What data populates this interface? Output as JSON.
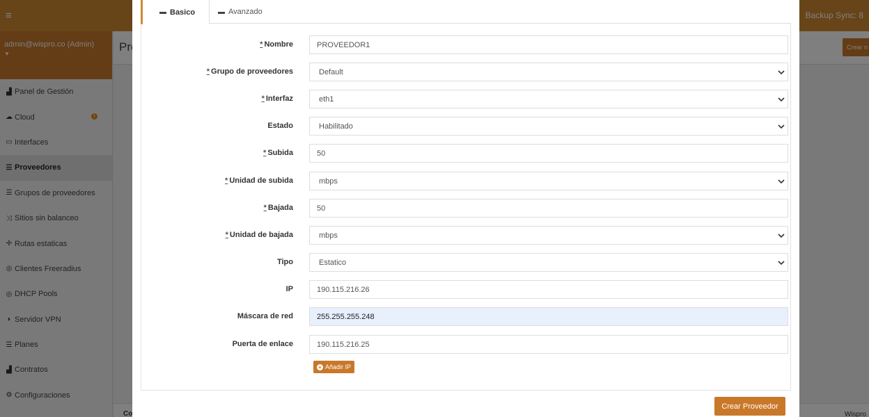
{
  "topbar": {
    "menu_icon": "hamburger-icon",
    "sync_text": "Backup Sync: 8"
  },
  "user": {
    "name": "admin@wispro.co (Admin)"
  },
  "sidebar": {
    "items": [
      {
        "label": "Panel de Gestión",
        "icon": "chart-area-icon"
      },
      {
        "label": "Cloud",
        "icon": "cloud-icon"
      },
      {
        "label": "Interfaces",
        "icon": "comment-icon"
      },
      {
        "label": "Proveedores",
        "icon": "list-icon"
      },
      {
        "label": "Grupos de proveedores",
        "icon": "list-icon"
      },
      {
        "label": "Sitios sin balanceo",
        "icon": "shuffle-icon"
      },
      {
        "label": "Rutas estaticas",
        "icon": "arrows-icon"
      },
      {
        "label": "Clientes Freeradius",
        "icon": "life-ring-icon"
      },
      {
        "label": "DHCP Pools",
        "icon": "life-ring-icon"
      },
      {
        "label": "Servidor VPN",
        "icon": "shield-icon"
      },
      {
        "label": "Planes",
        "icon": "list-icon"
      },
      {
        "label": "Contratos",
        "icon": "chart-area-icon"
      },
      {
        "label": "Configuraciones",
        "icon": "cogs-icon"
      }
    ],
    "active": "Proveedores"
  },
  "content": {
    "title": "Pro",
    "action_label": "Crear n",
    "footer_left": "Co",
    "footer_right": "Wispro"
  },
  "modal": {
    "tabs": [
      {
        "label": "Basico",
        "icon": "briefcase-icon",
        "active": true
      },
      {
        "label": "Avanzado",
        "icon": "briefcase-icon",
        "active": false
      }
    ],
    "fields": {
      "nombre": {
        "label": "Nombre",
        "required": true,
        "value": "PROVEEDOR1"
      },
      "grupo": {
        "label": "Grupo de proveedores",
        "required": true,
        "value": "Default"
      },
      "interfaz": {
        "label": "Interfaz",
        "required": true,
        "value": "eth1"
      },
      "estado": {
        "label": "Estado",
        "required": false,
        "value": "Habilitado"
      },
      "subida": {
        "label": "Subida",
        "required": true,
        "value": "50"
      },
      "unidad_subida": {
        "label": "Unidad de subida",
        "required": true,
        "value": "mbps"
      },
      "bajada": {
        "label": "Bajada",
        "required": true,
        "value": "50"
      },
      "unidad_bajada": {
        "label": "Unidad de bajada",
        "required": true,
        "value": "mbps"
      },
      "tipo": {
        "label": "Tipo",
        "required": false,
        "value": "Estatico"
      },
      "ip": {
        "label": "IP",
        "required": false,
        "value": "190.115.216.26"
      },
      "mascara": {
        "label": "Máscara de red",
        "required": false,
        "value": "255.255.255.248"
      },
      "puerta": {
        "label": "Puerta de enlace",
        "required": false,
        "value": "190.115.216.25"
      }
    },
    "required_mark": "*",
    "add_ip_label": "Añadir IP",
    "submit_label": "Crear Proveedor"
  },
  "colors": {
    "brand": "#d08a33",
    "button": "#c9782a",
    "focus_bg": "#e8f0fe"
  }
}
